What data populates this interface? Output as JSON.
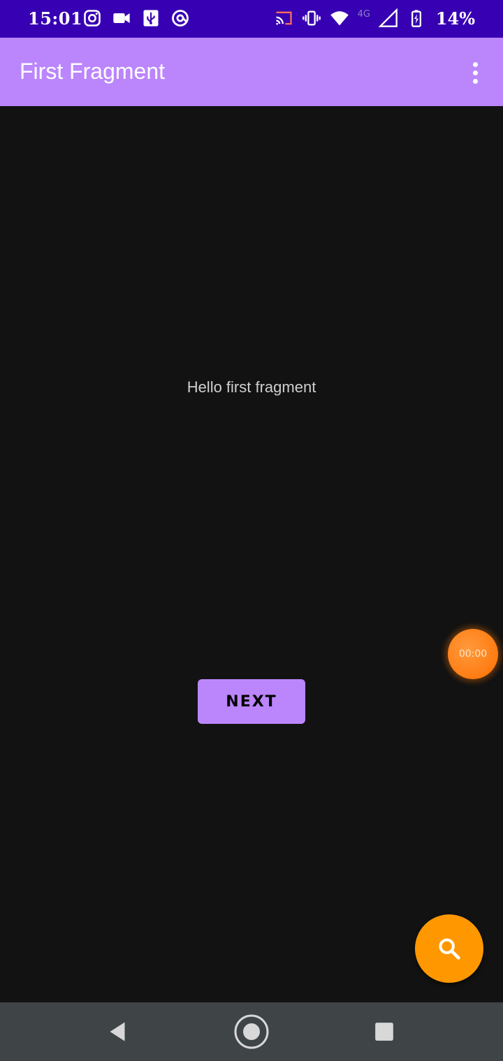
{
  "status_bar": {
    "time": "15:01",
    "battery_percent": "14%",
    "network_label": "4G",
    "left_icons": [
      "instagram-icon",
      "video-camera-icon",
      "usb-icon",
      "at-sign-icon"
    ],
    "right_icons": [
      "cast-icon",
      "vibrate-icon",
      "wifi-icon",
      "signal-icon",
      "battery-icon"
    ]
  },
  "app_bar": {
    "title": "First Fragment",
    "overflow_icon": "more-vert-icon",
    "color": "#bb86fc"
  },
  "content": {
    "text": "Hello first fragment",
    "next_button_label": "NEXT"
  },
  "overlay": {
    "timer_text": "00:00",
    "fab_icon": "search-icon",
    "fab_color": "#ff9800"
  },
  "nav_bar": {
    "icons": [
      "back-icon",
      "home-icon",
      "recents-icon"
    ]
  }
}
